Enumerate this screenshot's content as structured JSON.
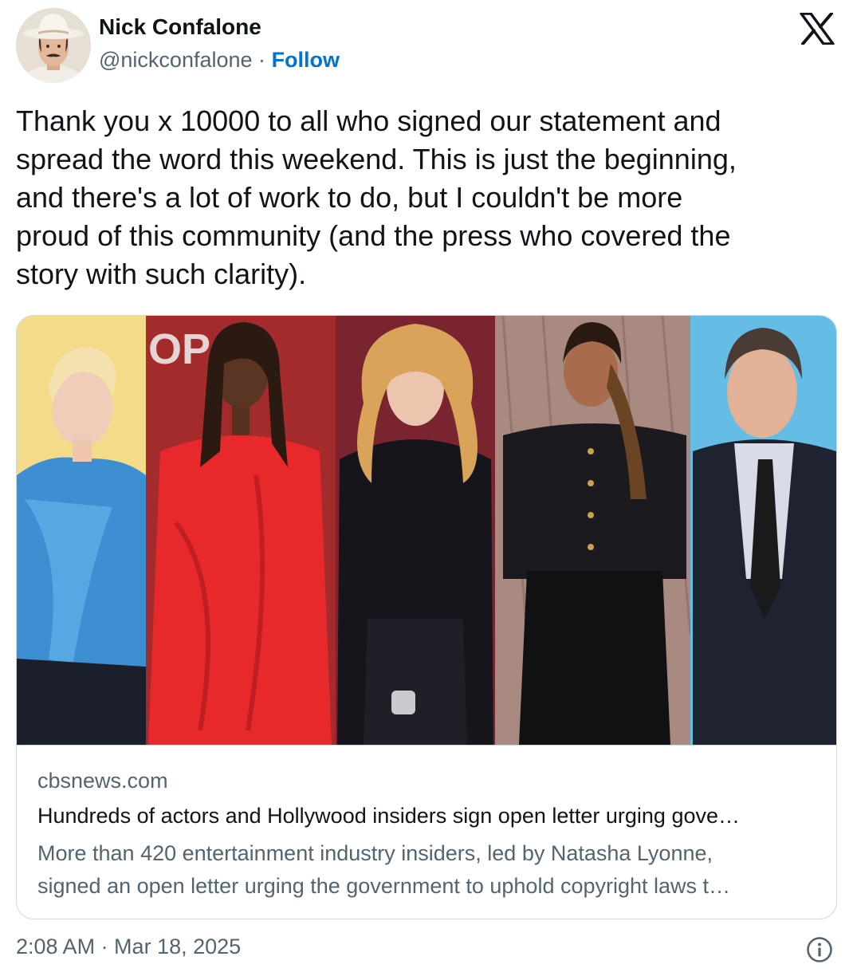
{
  "author": {
    "name": "Nick Confalone",
    "handle": "@nickconfalone",
    "separator": "·",
    "follow_label": "Follow"
  },
  "brand_icon": "x-logo-icon",
  "tweet": {
    "lines": [
      "Thank you x 10000 to all who signed our statement and",
      "spread the word this weekend. This is just the beginning,",
      "and there's a lot of work to do, but I couldn't be more",
      "proud of this community (and the press who covered the",
      "story with such clarity)."
    ]
  },
  "link_card": {
    "domain": "cbsnews.com",
    "title": "Hundreds of actors and Hollywood insiders sign open letter urging gove…",
    "description_lines": [
      "More than 420 entertainment industry insiders, led by Natasha Lyonne,",
      "signed an open letter urging the government to uphold copyright laws t…"
    ]
  },
  "timestamp": "2:08 AM · Mar 18, 2025",
  "info_icon": "info-icon",
  "colors": {
    "text": "#0f1419",
    "secondary": "#536471",
    "follow": "#0074d4",
    "border": "#cfd9de"
  }
}
